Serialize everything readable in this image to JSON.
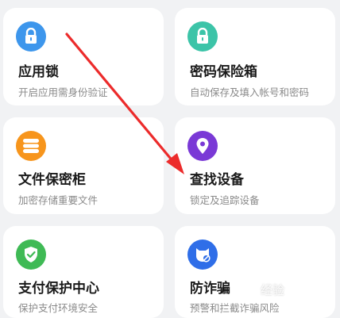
{
  "cards": [
    {
      "title": "应用锁",
      "subtitle": "开启应用需身份验证",
      "icon": "lock-icon",
      "color": "#3d96ec"
    },
    {
      "title": "密码保险箱",
      "subtitle": "自动保存及填入帐号和密码",
      "icon": "lock-icon",
      "color": "#3cc4a8"
    },
    {
      "title": "文件保密柜",
      "subtitle": "加密存储重要文件",
      "icon": "database-icon",
      "color": "#f7951c"
    },
    {
      "title": "查找设备",
      "subtitle": "锁定及追踪设备",
      "icon": "location-pin-icon",
      "color": "#7a39d6"
    },
    {
      "title": "支付保护中心",
      "subtitle": "保护支付环境安全",
      "icon": "shield-check-icon",
      "color": "#3fba55"
    },
    {
      "title": "防诈骗",
      "subtitle": "预警和拦截诈骗风险",
      "icon": "anti-fraud-icon",
      "color": "#2f6ee8"
    }
  ],
  "annotation": {
    "color": "#ec2b2b"
  },
  "watermark": {
    "text": "经验"
  }
}
